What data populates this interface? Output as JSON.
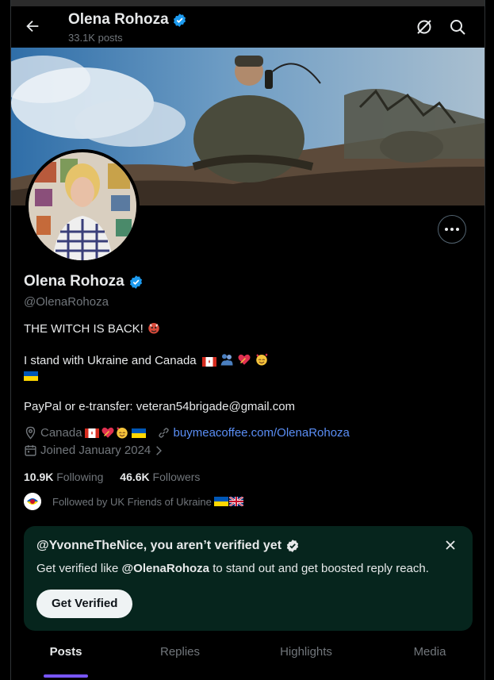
{
  "header": {
    "name": "Olena Rohoza",
    "posts": "33.1K posts"
  },
  "profile": {
    "name": "Olena Rohoza",
    "handle": "@OlenaRohoza",
    "bio_line1": "THE WITCH IS BACK!",
    "bio_line2": "I stand with Ukraine and Canada",
    "bio_line4": "PayPal or e-transfer: veteran54brigade@gmail.com",
    "location": "Canada",
    "website": "buymeacoffee.com/OlenaRohoza",
    "joined": "Joined January 2024",
    "following_count": "10.9K",
    "following_label": "Following",
    "followers_count": "46.6K",
    "followers_label": "Followers",
    "followed_by": "Followed by UK Friends of Ukraine"
  },
  "verify_card": {
    "title": "@YvonneTheNice, you aren’t verified yet",
    "text_prefix": "Get verified like ",
    "text_handle": "@OlenaRohoza",
    "text_suffix": " to stand out and get boosted reply reach.",
    "button": "Get Verified"
  },
  "tabs": [
    "Posts",
    "Replies",
    "Highlights",
    "Media"
  ],
  "active_tab": "Posts",
  "colors": {
    "accent": "#1d9bf0",
    "link": "#5a8ef5",
    "tab_indicator": "#7856ff",
    "card_bg": "#06251d"
  }
}
